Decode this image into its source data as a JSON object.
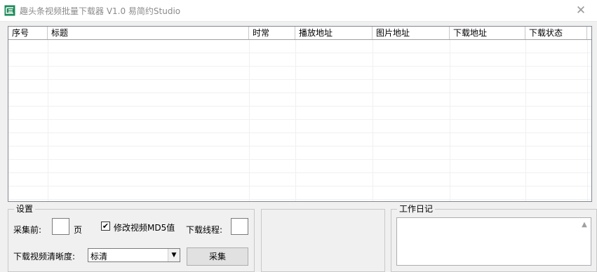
{
  "window": {
    "title": "趣头条视频批量下载器 V1.0  易简约Studio",
    "close_symbol": "✕"
  },
  "list": {
    "columns": [
      "序号",
      "标题",
      "时常",
      "播放地址",
      "图片地址",
      "下载地址",
      "下载状态"
    ],
    "rows": []
  },
  "settings": {
    "group_title": "设置",
    "pages_label": "采集前:",
    "pages_value": "",
    "pages_unit": "页",
    "md5_checkbox_checked": true,
    "md5_label": "修改视频MD5值",
    "threads_label": "下载线程:",
    "threads_value": "",
    "quality_label": "下载视频清晰度:",
    "quality_value": "标清",
    "collect_button": "采集"
  },
  "log": {
    "group_title": "工作日记",
    "content": ""
  },
  "colors": {
    "icon_green": "#1f8a5b",
    "title_gray": "#8a8a8a"
  }
}
